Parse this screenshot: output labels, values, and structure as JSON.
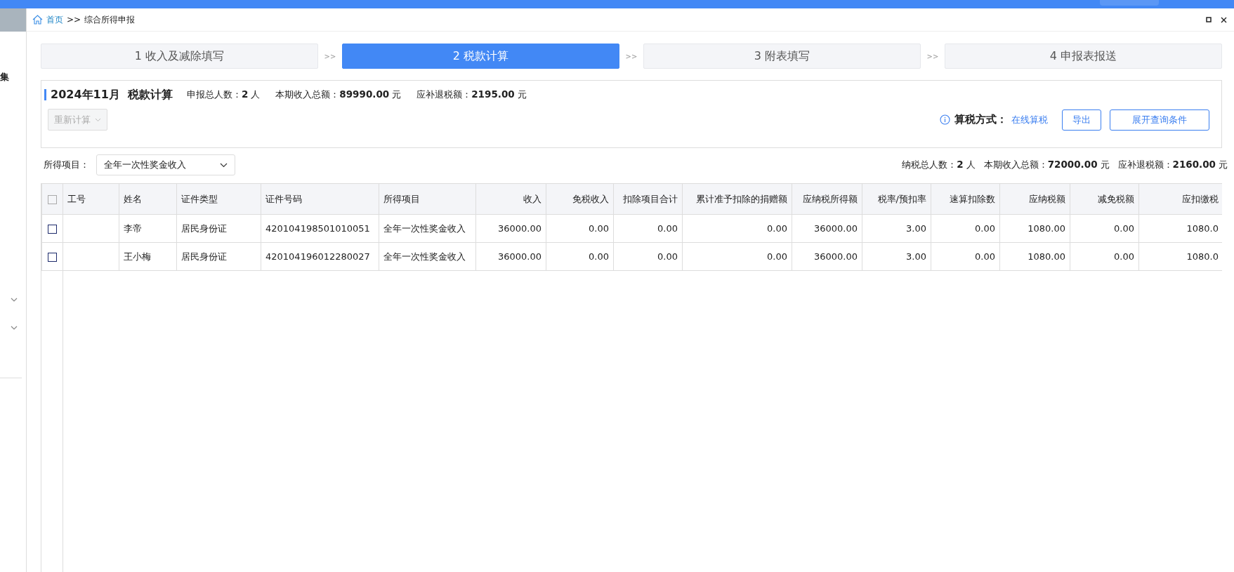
{
  "sidebar": {
    "label": "集",
    "menus": [
      {
        "expanded": false
      },
      {
        "expanded": false
      }
    ]
  },
  "breadcrumb": {
    "home": "首页",
    "separator": ">>",
    "current": "综合所得申报"
  },
  "steps": [
    {
      "label": "1 收入及减除填写",
      "selected": false
    },
    {
      "label": "2 税款计算",
      "selected": true
    },
    {
      "label": "3 附表填写",
      "selected": false
    },
    {
      "label": "4 申报表报送",
      "selected": false
    }
  ],
  "step_separator": ">>",
  "summary": {
    "title": "2024年11月  税款计算",
    "stats": [
      {
        "label": "申报总人数：",
        "value": "2",
        "unit": "人"
      },
      {
        "label": "本期收入总额：",
        "value": "89990.00",
        "unit": "元"
      },
      {
        "label": "应补退税额：",
        "value": "2195.00",
        "unit": "元"
      }
    ],
    "recalc_button": {
      "label": "重新计算",
      "disabled": true
    },
    "method_label": "算税方式：",
    "method_value": "在线算税",
    "buttons": [
      "导出",
      "展开查询条件"
    ]
  },
  "filter": {
    "label": "所得项目：",
    "value": "全年一次性奖金收入"
  },
  "totals": [
    {
      "label": "纳税总人数：",
      "value": "2",
      "unit": "人"
    },
    {
      "label": "本期收入总额：",
      "value": "72000.00",
      "unit": "元"
    },
    {
      "label": "应补退税额：",
      "value": "2160.00",
      "unit": "元"
    }
  ],
  "table": {
    "header_checked": false,
    "columns": [
      "工号",
      "姓名",
      "证件类型",
      "证件号码",
      "所得项目",
      "收入",
      "免税收入",
      "扣除项目合计",
      "累计准予扣除的捐赠额",
      "应纳税所得额",
      "税率/预扣率",
      "速算扣除数",
      "应纳税额",
      "减免税额",
      "应扣缴税"
    ],
    "rows": [
      {
        "checked": false,
        "cells": [
          "",
          "李帝",
          "居民身份证",
          "420104198501010051",
          "全年一次性奖金收入",
          "36000.00",
          "0.00",
          "0.00",
          "0.00",
          "36000.00",
          "3.00",
          "0.00",
          "1080.00",
          "0.00",
          "1080.0"
        ]
      },
      {
        "checked": false,
        "cells": [
          "",
          "王小梅",
          "居民身份证",
          "420104196012280027",
          "全年一次性奖金收入",
          "36000.00",
          "0.00",
          "0.00",
          "0.00",
          "36000.00",
          "3.00",
          "0.00",
          "1080.00",
          "0.00",
          "1080.0"
        ]
      }
    ]
  }
}
